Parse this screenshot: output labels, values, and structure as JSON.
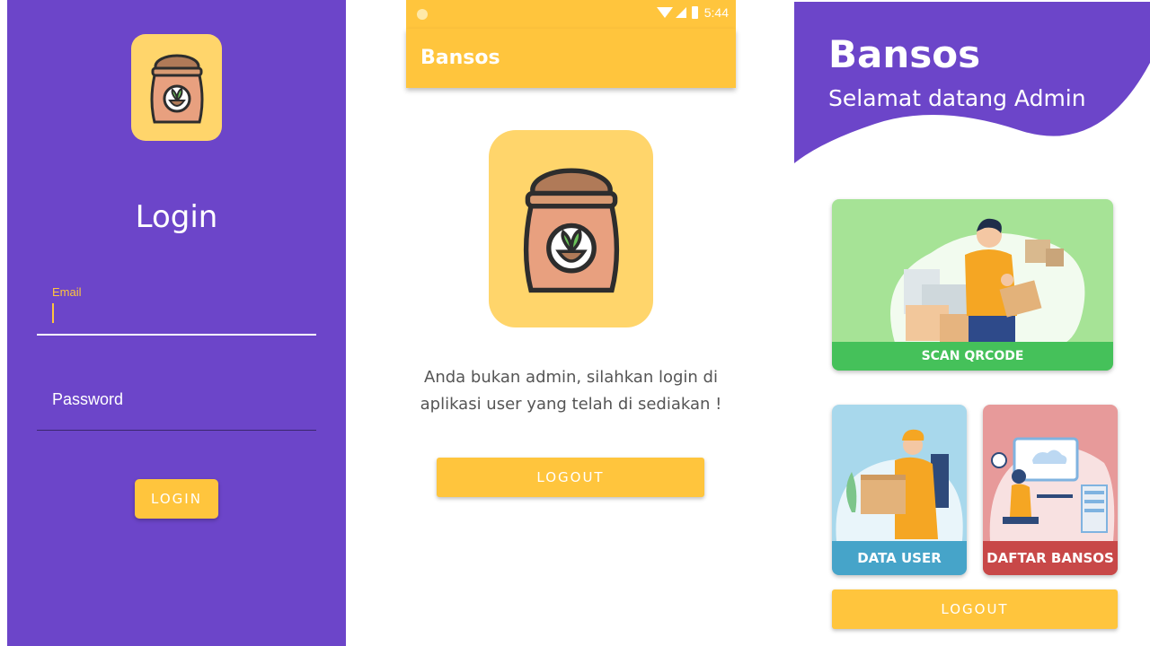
{
  "login_screen": {
    "title": "Login",
    "email_label": "Email",
    "password_placeholder": "Password",
    "login_button": "LOGIN"
  },
  "not_admin_screen": {
    "status_time": "5:44",
    "appbar_title": "Bansos",
    "message": "Anda bukan admin, silahkan login di aplikasi user yang telah di sediakan !",
    "logout_button": "LOGOUT"
  },
  "admin_screen": {
    "title": "Bansos",
    "subtitle": "Selamat datang Admin",
    "cards": {
      "scan": "SCAN QRCODE",
      "data_user": "DATA USER",
      "daftar_bansos": "DAFTAR BANSOS"
    },
    "logout_button": "LOGOUT"
  },
  "colors": {
    "purple": "#6c45c9",
    "yellow": "#ffc53d",
    "logo_bg": "#ffd56b",
    "green": "#45c15a",
    "blue": "#46a4c9",
    "red": "#c84848"
  },
  "icons": [
    "sack-logo-icon",
    "wifi-icon",
    "signal-icon",
    "battery-icon"
  ]
}
